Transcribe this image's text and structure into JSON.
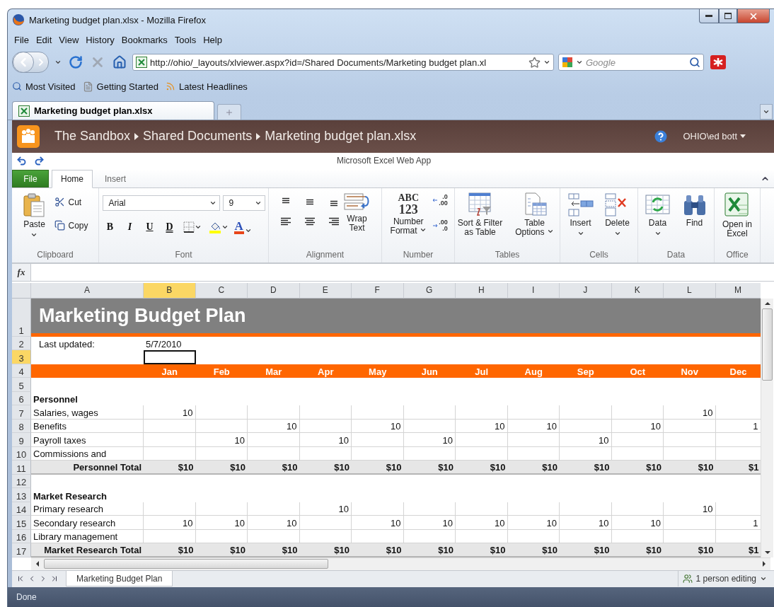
{
  "window": {
    "title": "Marketing budget plan.xlsx - Mozilla Firefox"
  },
  "menu": [
    "File",
    "Edit",
    "View",
    "History",
    "Bookmarks",
    "Tools",
    "Help"
  ],
  "address": {
    "url": "http://ohio/_layouts/xlviewer.aspx?id=/Shared Documents/Marketing budget plan.xl"
  },
  "search": {
    "placeholder": "Google"
  },
  "bookmarks": [
    "Most Visited",
    "Getting Started",
    "Latest Headlines"
  ],
  "browser_tabs": [
    {
      "label": "Marketing budget plan.xlsx",
      "selected": true
    }
  ],
  "site": {
    "breadcrumb": [
      "The Sandbox",
      "Shared Documents",
      "Marketing budget plan.xlsx"
    ],
    "user": "OHIO\\ed bott"
  },
  "app_title": "Microsoft Excel Web App",
  "ribbon": {
    "file": "File",
    "tabs": [
      {
        "label": "Home",
        "selected": true
      },
      {
        "label": "Insert",
        "selected": false
      }
    ],
    "groups": [
      {
        "kind": "clipboard",
        "label": "Clipboard",
        "buttons": [
          "Paste",
          "Cut",
          "Copy"
        ]
      },
      {
        "kind": "font",
        "label": "Font",
        "font": "Arial",
        "size": "9",
        "styles": [
          "B",
          "I",
          "U",
          "D"
        ],
        "font_color": "A"
      },
      {
        "kind": "alignment",
        "label": "Alignment",
        "buttons": [
          "Wrap Text"
        ]
      },
      {
        "kind": "number",
        "label": "Number",
        "icon_text": [
          "ABC",
          "123"
        ],
        "buttons": [
          "Number Format"
        ],
        "decimals": [
          {
            "top": ".0",
            "bottom": ".00"
          },
          {
            "top": ".00",
            "bottom": ".0"
          }
        ]
      },
      {
        "kind": "tables",
        "label": "Tables",
        "buttons": [
          {
            "label": "Sort & Filter as Table",
            "menu": false
          },
          {
            "label": "Table Options",
            "menu": true
          }
        ]
      },
      {
        "kind": "cells",
        "label": "Cells",
        "buttons": [
          {
            "label": "Insert",
            "menu": true
          },
          {
            "label": "Delete",
            "menu": true
          }
        ]
      },
      {
        "kind": "data",
        "label": "Data",
        "buttons": [
          {
            "label": "Data",
            "menu": true
          },
          {
            "label": "Find",
            "menu": false
          }
        ]
      },
      {
        "kind": "office",
        "label": "Office",
        "buttons": [
          {
            "label": "Open in Excel",
            "menu": false
          }
        ]
      }
    ]
  },
  "formula_bar": {
    "label": "fx"
  },
  "sheet": {
    "columns": [
      {
        "label": "A",
        "selected": false
      },
      {
        "label": "B",
        "selected": true
      },
      {
        "label": "C",
        "selected": false
      },
      {
        "label": "D",
        "selected": false
      },
      {
        "label": "E",
        "selected": false
      },
      {
        "label": "F",
        "selected": false
      },
      {
        "label": "G",
        "selected": false
      },
      {
        "label": "H",
        "selected": false
      },
      {
        "label": "I",
        "selected": false
      },
      {
        "label": "J",
        "selected": false
      },
      {
        "label": "K",
        "selected": false
      },
      {
        "label": "L",
        "selected": false
      },
      {
        "label": "M",
        "selected": false
      }
    ],
    "rows": [
      {
        "number": "1",
        "kind": "title",
        "selected": false,
        "text": "Marketing Budget Plan"
      },
      {
        "number": "2",
        "kind": "info",
        "selected": false,
        "label": "Last updated:",
        "value": "5/7/2010"
      },
      {
        "number": "3",
        "kind": "blank",
        "selected": true
      },
      {
        "number": "4",
        "kind": "months",
        "selected": false,
        "values": [
          "Jan",
          "Feb",
          "Mar",
          "Apr",
          "May",
          "Jun",
          "Jul",
          "Aug",
          "Sep",
          "Oct",
          "Nov",
          "Dec"
        ]
      },
      {
        "number": "5",
        "kind": "blank",
        "selected": false
      },
      {
        "number": "6",
        "kind": "section",
        "selected": false,
        "label": "Personnel"
      },
      {
        "number": "7",
        "kind": "data",
        "selected": false,
        "label": "Salaries, wages",
        "values": {
          "B": "10",
          "L": "10"
        }
      },
      {
        "number": "8",
        "kind": "data",
        "selected": false,
        "label": "Benefits",
        "values": {
          "D": "10",
          "F": "10",
          "H": "10",
          "I": "10",
          "K": "10",
          "M": "1"
        }
      },
      {
        "number": "9",
        "kind": "data",
        "selected": false,
        "label": "Payroll taxes",
        "values": {
          "C": "10",
          "E": "10",
          "G": "10",
          "J": "10"
        }
      },
      {
        "number": "10",
        "kind": "data",
        "selected": false,
        "label": "Commissions and"
      },
      {
        "number": "11",
        "kind": "total",
        "selected": false,
        "label": "Personnel Total",
        "values": [
          "$10",
          "$10",
          "$10",
          "$10",
          "$10",
          "$10",
          "$10",
          "$10",
          "$10",
          "$10",
          "$10",
          "$1"
        ]
      },
      {
        "number": "12",
        "kind": "blank",
        "selected": false
      },
      {
        "number": "13",
        "kind": "section",
        "selected": false,
        "label": "Market Research"
      },
      {
        "number": "14",
        "kind": "data",
        "selected": false,
        "label": "Primary research",
        "values": {
          "E": "10",
          "L": "10"
        }
      },
      {
        "number": "15",
        "kind": "data",
        "selected": false,
        "label": "Secondary research",
        "values": {
          "B": "10",
          "C": "10",
          "D": "10",
          "F": "10",
          "G": "10",
          "H": "10",
          "I": "10",
          "J": "10",
          "K": "10",
          "M": "1"
        }
      },
      {
        "number": "16",
        "kind": "data",
        "selected": false,
        "label": "Library management"
      },
      {
        "number": "17",
        "kind": "total",
        "selected": false,
        "label": "Market Research Total",
        "values": [
          "$10",
          "$10",
          "$10",
          "$10",
          "$10",
          "$10",
          "$10",
          "$10",
          "$10",
          "$10",
          "$10",
          "$1"
        ]
      }
    ]
  },
  "sheet_tabs": [
    {
      "label": "Marketing Budget Plan",
      "selected": true
    }
  ],
  "editing": "1 person editing",
  "status": "Done"
}
